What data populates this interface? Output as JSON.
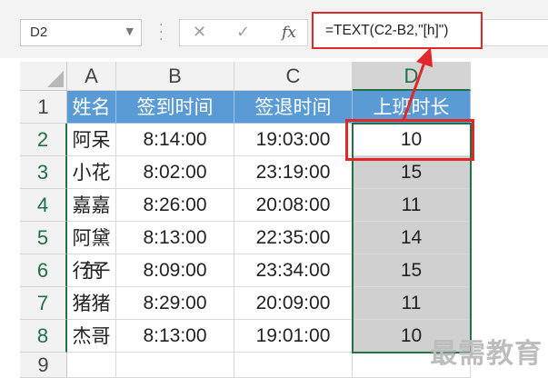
{
  "name_box": {
    "value": "D2"
  },
  "formula_bar": {
    "formula": "=TEXT(C2-B2,\"[h]\")",
    "cancel_glyph": "✕",
    "enter_glyph": "✓",
    "fx_glyph": "fx"
  },
  "columns": [
    "A",
    "B",
    "C",
    "D"
  ],
  "rows": [
    "1",
    "2",
    "3",
    "4",
    "5",
    "6",
    "7",
    "8",
    "9"
  ],
  "header_row": [
    "姓名",
    "签到时间",
    "签退时间",
    "上班时长"
  ],
  "data_rows": [
    [
      "阿呆",
      "8:14:00",
      "19:03:00",
      "10"
    ],
    [
      "小花",
      "8:02:00",
      "23:19:00",
      "15"
    ],
    [
      "嘉嘉",
      "8:26:00",
      "20:08:00",
      "11"
    ],
    [
      "阿黛尔",
      "8:13:00",
      "22:35:00",
      "14"
    ],
    [
      "行子",
      "8:09:00",
      "23:34:00",
      "15"
    ],
    [
      "猪猪",
      "8:29:00",
      "20:09:00",
      "11"
    ],
    [
      "杰哥",
      "8:13:00",
      "19:01:00",
      "10"
    ]
  ],
  "watermark": "最需教育",
  "colors": {
    "header_fill": "#5b9bd5",
    "selection": "#217346",
    "highlight": "#e0282a",
    "selected_fill": "#d0d0d0"
  }
}
